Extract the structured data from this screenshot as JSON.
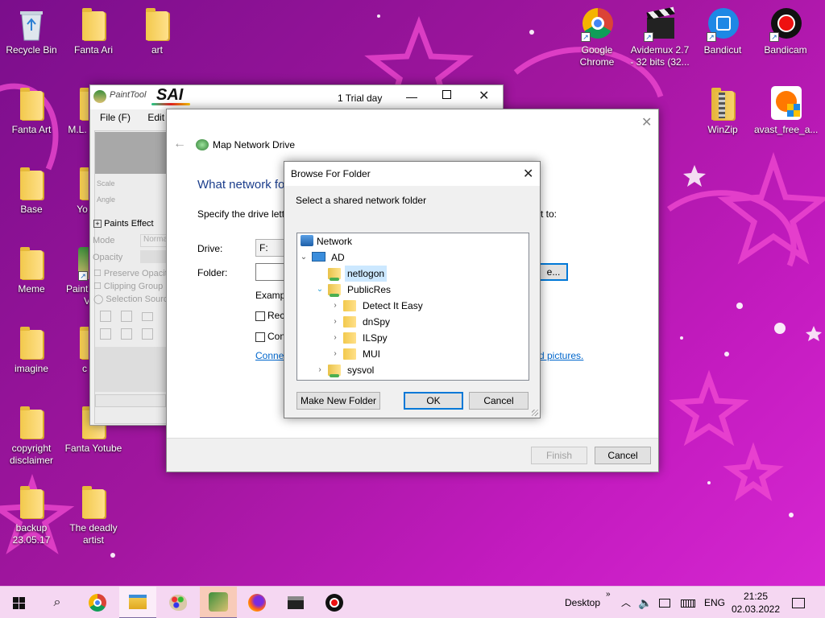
{
  "desktop": {
    "icons_left": [
      {
        "label": "Recycle Bin",
        "type": "recycle"
      },
      {
        "label": "Fanta Ari",
        "type": "folder"
      },
      {
        "label": "art",
        "type": "folder"
      },
      {
        "label": "Fanta Art",
        "type": "folder"
      },
      {
        "label": "M.L.",
        "type": "folder"
      },
      {
        "label": "Base",
        "type": "folder"
      },
      {
        "label": "Yo",
        "type": "folder"
      },
      {
        "label": "Meme",
        "type": "folder"
      },
      {
        "label": "PaintT",
        "label2": "V",
        "type": "app"
      },
      {
        "label": "imagine",
        "type": "folder"
      },
      {
        "label": "c",
        "type": "folder"
      },
      {
        "label": "copyright",
        "label2": "disclaimer",
        "type": "folder"
      },
      {
        "label": "Fanta Yotube",
        "type": "folder"
      },
      {
        "label": "backup",
        "label2": "23.05.17",
        "type": "folder"
      },
      {
        "label": "The deadly",
        "label2": "artist",
        "type": "folder"
      }
    ],
    "icons_right": [
      {
        "label": "Google",
        "label2": "Chrome",
        "type": "chrome"
      },
      {
        "label": "Avidemux 2.7",
        "label2": "- 32 bits (32...",
        "type": "avidemux"
      },
      {
        "label": "Bandicut",
        "type": "bandicut"
      },
      {
        "label": "Bandicam",
        "type": "bandicam"
      },
      {
        "label": "WinZip",
        "type": "winzip"
      },
      {
        "label": "avast_free_a...",
        "type": "avast"
      }
    ]
  },
  "sai": {
    "logo_text": "PaintTool",
    "logo_brand": "SAI",
    "trial": "1 Trial day",
    "menu": [
      "File (F)",
      "Edit (E"
    ],
    "panel_title": "Paints Effect",
    "options": [
      "Mode",
      "Opacity",
      "Preserve Opacity",
      "Clipping Group",
      "Selection Source"
    ],
    "mode_value": "Norma",
    "slider_labels": [
      "Scale",
      "Angle"
    ]
  },
  "map_drive": {
    "title": "Map Network Drive",
    "heading": "What network fo",
    "description": "Specify the drive lett",
    "description_tail": "t to:",
    "drive_label": "Drive:",
    "drive_value": "F:",
    "folder_label": "Folder:",
    "browse_label": "e...",
    "example_label": "Examp",
    "reconnect_label": "Rec",
    "connect_label": "Con",
    "link_left": "Connec",
    "link_right": "d pictures.",
    "finish_label": "Finish",
    "cancel_label": "Cancel"
  },
  "browse_folder": {
    "title": "Browse For Folder",
    "instruction": "Select a shared network folder",
    "tree": [
      {
        "label": "Network",
        "level": 0,
        "chevron": "",
        "icon": "network"
      },
      {
        "label": "AD",
        "level": 0,
        "chevron": "v",
        "icon": "computer"
      },
      {
        "label": "netlogon",
        "level": 1,
        "chevron": "",
        "icon": "share",
        "selected": true
      },
      {
        "label": "PublicRes",
        "level": 1,
        "chevron": "v",
        "icon": "share"
      },
      {
        "label": "Detect It Easy",
        "level": 2,
        "chevron": ">",
        "icon": "folder"
      },
      {
        "label": "dnSpy",
        "level": 2,
        "chevron": ">",
        "icon": "folder"
      },
      {
        "label": "ILSpy",
        "level": 2,
        "chevron": ">",
        "icon": "folder"
      },
      {
        "label": "MUI",
        "level": 2,
        "chevron": ">",
        "icon": "folder"
      },
      {
        "label": "sysvol",
        "level": 1,
        "chevron": ">",
        "icon": "share"
      }
    ],
    "make_new_folder_label": "Make New Folder",
    "ok_label": "OK",
    "cancel_label": "Cancel"
  },
  "taskbar": {
    "items": [
      "windows-start",
      "search",
      "chrome",
      "file-explorer",
      "paint-palette",
      "paintool-sai",
      "firefox",
      "avidemux",
      "bandicam"
    ],
    "desktop_label": "Desktop",
    "overflow": "»",
    "language": "ENG",
    "time": "21:25",
    "date": "02.03.2022"
  },
  "colors": {
    "accent": "#0078d7",
    "link": "#0066cc",
    "selection": "#cce8ff",
    "taskbar": "#f5d7f2"
  }
}
